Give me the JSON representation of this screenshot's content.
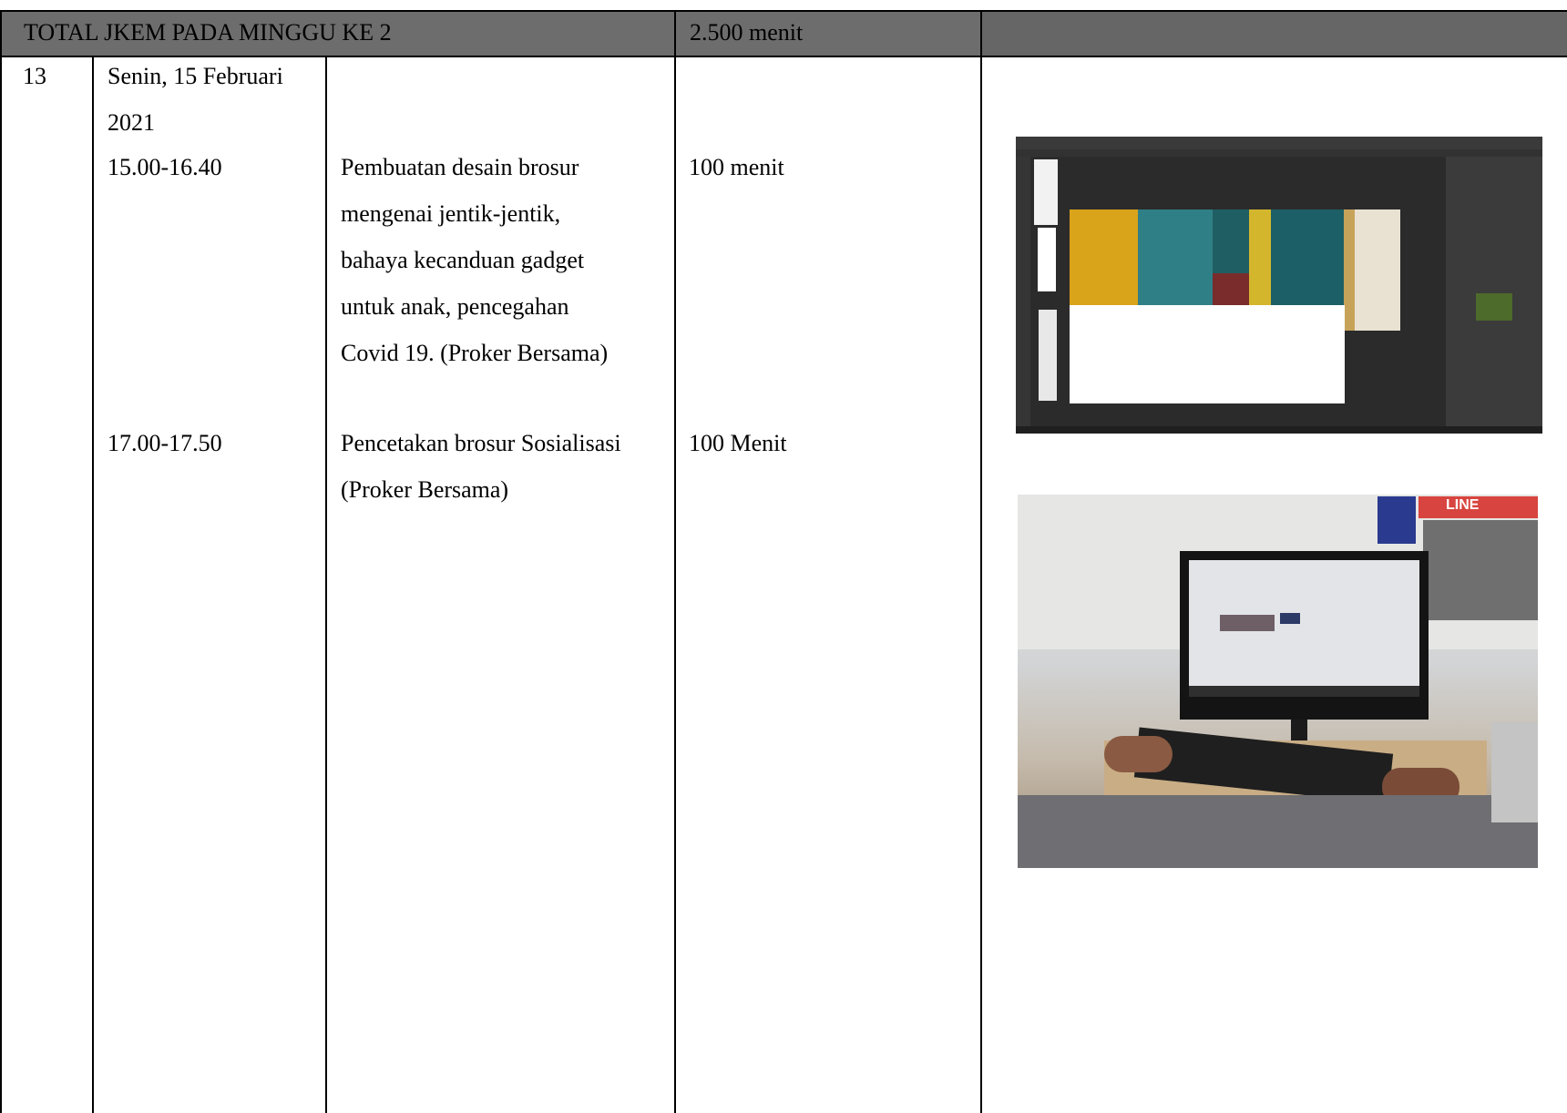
{
  "header": {
    "total_label": "TOTAL JKEM PADA MINGGU KE 2",
    "total_value": "2.500 menit"
  },
  "entry": {
    "number": "13",
    "date_line1": "Senin, 15 Februari",
    "date_line2": "2021",
    "activities": [
      {
        "time": "15.00-16.40",
        "description_lines": [
          "Pembuatan desain brosur",
          "mengenai jentik-jentik,",
          "bahaya kecanduan gadget",
          "untuk anak, pencegahan",
          "Covid 19. (Proker Bersama)"
        ],
        "duration": "100 menit"
      },
      {
        "time": "17.00-17.50",
        "description_lines": [
          "Pencetakan brosur Sosialisasi",
          "(Proker Bersama)"
        ],
        "duration": "100 Menit"
      }
    ]
  },
  "photo_sign_text": "LINE",
  "colors": {
    "header_fill": "#6d6d6d",
    "grid_line": "#000000"
  }
}
